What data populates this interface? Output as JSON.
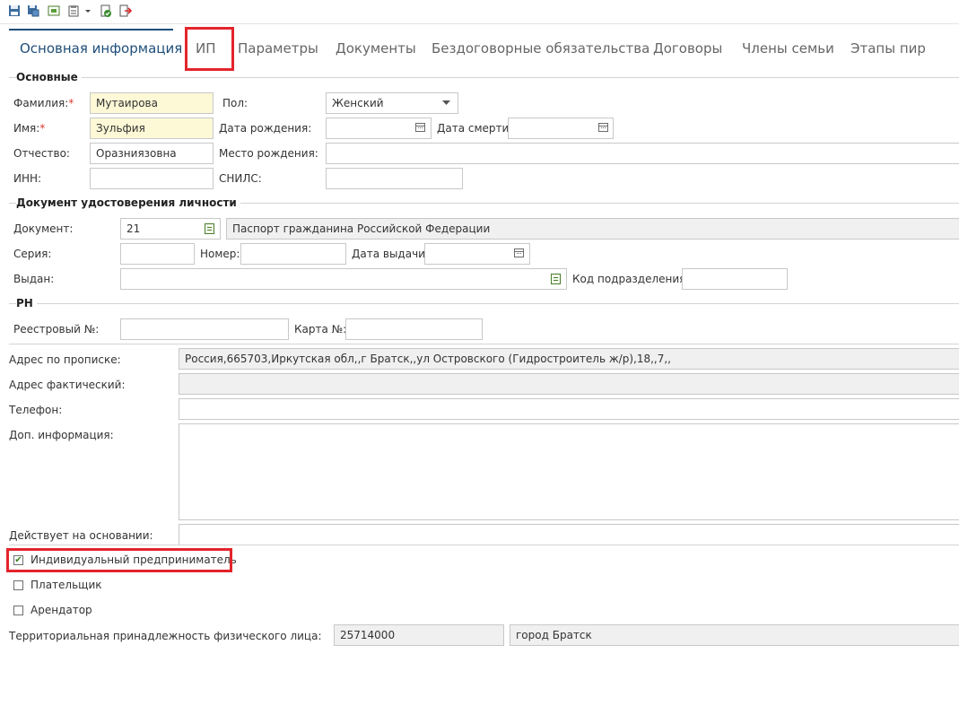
{
  "toolbar": {
    "icons": [
      "save-icon",
      "save-and-close-icon",
      "preview-icon",
      "clipboard-icon",
      "chevron-down-icon",
      "check-document-icon",
      "exit-icon"
    ]
  },
  "tabs": [
    {
      "label": "Основная информация",
      "active": true
    },
    {
      "label": "ИП",
      "active": false
    },
    {
      "label": "Параметры",
      "active": false
    },
    {
      "label": "Документы",
      "active": false
    },
    {
      "label": "Бездоговорные обязательства",
      "active": false
    },
    {
      "label": "Договоры",
      "active": false
    },
    {
      "label": "Члены семьи",
      "active": false
    },
    {
      "label": "Этапы пир",
      "active": false
    }
  ],
  "basic": {
    "title": "Основные",
    "surname_label": "Фамилия:",
    "surname_value": "Мутаирова",
    "name_label": "Имя:",
    "name_value": "Зульфия",
    "patronymic_label": "Отчество:",
    "patronymic_value": "Оразниязовна",
    "inn_label": "ИНН:",
    "inn_value": "",
    "gender_label": "Пол:",
    "gender_value": "Женский",
    "birth_date_label": "Дата рождения:",
    "birth_date_value": "",
    "death_date_label": "Дата смерти:",
    "death_date_value": "",
    "birth_place_label": "Место рождения:",
    "birth_place_value": "",
    "snils_label": "СНИЛС:",
    "snils_value": "",
    "required_mark": "*"
  },
  "identity": {
    "title": "Документ удостоверения личности",
    "document_label": "Документ:",
    "document_code": "21",
    "document_name": "Паспорт гражданина Российской Федерации",
    "series_label": "Серия:",
    "series_value": "",
    "number_label": "Номер:",
    "number_value": "",
    "issue_date_label": "Дата выдачи:",
    "issue_date_value": "",
    "issued_by_label": "Выдан:",
    "issued_by_value": "",
    "division_code_label": "Код подразделения:",
    "division_code_value": ""
  },
  "rn": {
    "title": "РН",
    "registry_label": "Реестровый №:",
    "registry_value": "",
    "card_label": "Карта №:",
    "card_value": ""
  },
  "address": {
    "registration_label": "Адрес по прописке:",
    "registration_value": "Россия,665703,Иркутская обл,,г Братск,,ул Островского (Гидростроитель ж/р),18,,7,,",
    "actual_label": "Адрес фактический:",
    "actual_value": "",
    "phone_label": "Телефон:",
    "phone_value": "",
    "extra_info_label": "Доп. информация:",
    "extra_info_value": "",
    "basis_label": "Действует на основании:",
    "basis_value": ""
  },
  "checkboxes": [
    {
      "label": "Индивидуальный предприниматель",
      "checked": true
    },
    {
      "label": "Плательщик",
      "checked": false
    },
    {
      "label": "Арендатор",
      "checked": false
    }
  ],
  "territory": {
    "label": "Территориальная принадлежность физического лица:",
    "code": "25714000",
    "name": "город Братск"
  },
  "colors": {
    "accent": "#1f4e79",
    "highlight": "#e3242b",
    "required_bg": "#fdf8d6",
    "readonly_bg": "#f0f0f0"
  }
}
